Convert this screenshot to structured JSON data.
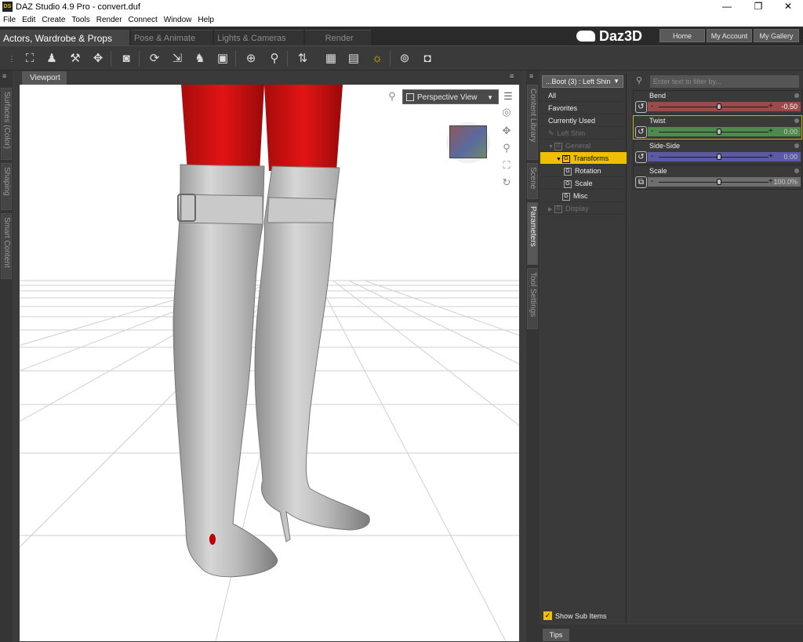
{
  "window": {
    "title": "DAZ Studio 4.9 Pro - convert.duf",
    "app_icon": "DS",
    "minimize": "—",
    "restore": "❐",
    "close": "✕"
  },
  "menu": [
    "File",
    "Edit",
    "Create",
    "Tools",
    "Render",
    "Connect",
    "Window",
    "Help"
  ],
  "tabs": [
    "Actors, Wardrobe & Props",
    "Pose & Animate",
    "Lights & Cameras",
    "Render"
  ],
  "logo": "Daz3D",
  "top_buttons": [
    "Home",
    "My Account",
    "My Gallery"
  ],
  "left_side_tabs": [
    "Surfaces (Color)",
    "Shaping",
    "Smart Content"
  ],
  "right_side_tabs": [
    "Content Library",
    "Scene",
    "Parameters",
    "Tool Settings"
  ],
  "viewport": {
    "tab": "Viewport",
    "view_select": "Perspective View"
  },
  "node_selector": "...Boot (3) : Left Shin",
  "tree": [
    {
      "label": "All",
      "indent": 0,
      "state": "normal"
    },
    {
      "label": "Favorites",
      "indent": 0,
      "state": "normal"
    },
    {
      "label": "Currently Used",
      "indent": 0,
      "state": "normal"
    },
    {
      "label": "Left Shin",
      "indent": 0,
      "state": "dim"
    },
    {
      "label": "General",
      "indent": 1,
      "state": "dim"
    },
    {
      "label": "Transforms",
      "indent": 2,
      "state": "selected"
    },
    {
      "label": "Rotation",
      "indent": 3,
      "state": "normal"
    },
    {
      "label": "Scale",
      "indent": 3,
      "state": "normal"
    },
    {
      "label": "Misc",
      "indent": 2,
      "state": "normal"
    },
    {
      "label": "Display",
      "indent": 1,
      "state": "dim"
    }
  ],
  "filter_placeholder": "Enter text to filter by...",
  "parameters": [
    {
      "label": "Bend",
      "value": "-0.50",
      "slider_fraction": 0.55,
      "color": "#9c4a4a"
    },
    {
      "label": "Twist",
      "value": "0.00",
      "slider_fraction": 0.55,
      "color": "#4e8a4e"
    },
    {
      "label": "Side-Side",
      "value": "0.00",
      "slider_fraction": 0.55,
      "color": "#5a5aa6"
    },
    {
      "label": "Scale",
      "value": "100.0%",
      "slider_fraction": 0.55,
      "color": "#6e6e6e"
    }
  ],
  "show_sub_items": "Show Sub Items",
  "tips": "Tips",
  "colors": {
    "accent": "#f0c000",
    "viewport_bg": "#ffffff",
    "boot": "#b8b8b8",
    "leg": "#d40f0f"
  }
}
